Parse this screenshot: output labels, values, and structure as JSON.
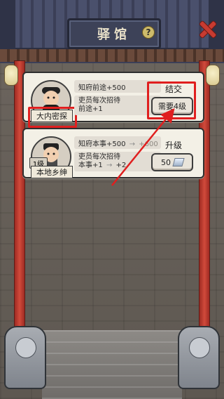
{
  "header": {
    "title": "驿馆",
    "help_symbol": "?"
  },
  "officers": [
    {
      "name": "大内密探",
      "stats": {
        "line1": "知府前途+500",
        "line2a": "吏员每次招待",
        "line2b": "前途+1"
      },
      "action": {
        "title": "结交",
        "button": "需要4级"
      }
    },
    {
      "name": "本地乡绅",
      "level": "1级",
      "stats": {
        "line1_prefix": "知府本事+500",
        "line1_arrow": "→",
        "line1_next": "+600",
        "line2a": "吏员每次招待",
        "line2b_prefix": "本事+1",
        "line2b_arrow": "→",
        "line2b_next": "+2"
      },
      "action": {
        "title": "升级",
        "button_value": "50"
      }
    }
  ],
  "icons": [
    "help-icon",
    "close-icon",
    "silver-icon"
  ],
  "colors": {
    "highlight_red": "#e01f1f",
    "accent_red": "#c83b31"
  }
}
